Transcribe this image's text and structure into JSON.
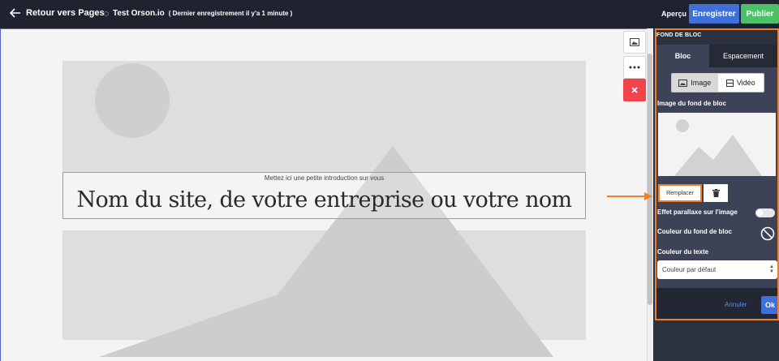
{
  "topbar": {
    "back_label": "Retour vers Pages",
    "site_name": "Test Orson.io",
    "save_status": "( Dernier enregistrement il y'a 1 minute )",
    "preview_label": "Aperçu",
    "save_label": "Enregistrer",
    "publish_label": "Publier"
  },
  "canvas": {
    "intro": "Mettez ici une petite introduction sur vous",
    "headline": "Nom du site, de votre entreprise ou votre nom"
  },
  "panel": {
    "title": "FOND DE BLOC",
    "tabs": [
      {
        "label": "Bloc",
        "active": true
      },
      {
        "label": "Espacement",
        "active": false
      }
    ],
    "media_options": [
      {
        "label": "Image",
        "active": true
      },
      {
        "label": "Vidéo",
        "active": false
      }
    ],
    "image_label": "Image du fond de bloc",
    "replace_label": "Remplacer",
    "parallax_label": "Effet parallaxe sur l'image",
    "parallax_on": false,
    "bg_color_label": "Couleur du fond de bloc",
    "text_color_label": "Couleur du texte",
    "text_color_value": "Couleur par défaut",
    "cancel_label": "Annuler",
    "ok_label": "Ok"
  },
  "colors": {
    "topbar": "#1f2330",
    "save": "#3f6fd8",
    "publish": "#4cc168",
    "delete": "#f0444a",
    "highlight": "#f07e2a",
    "panel": "#3d4356"
  }
}
